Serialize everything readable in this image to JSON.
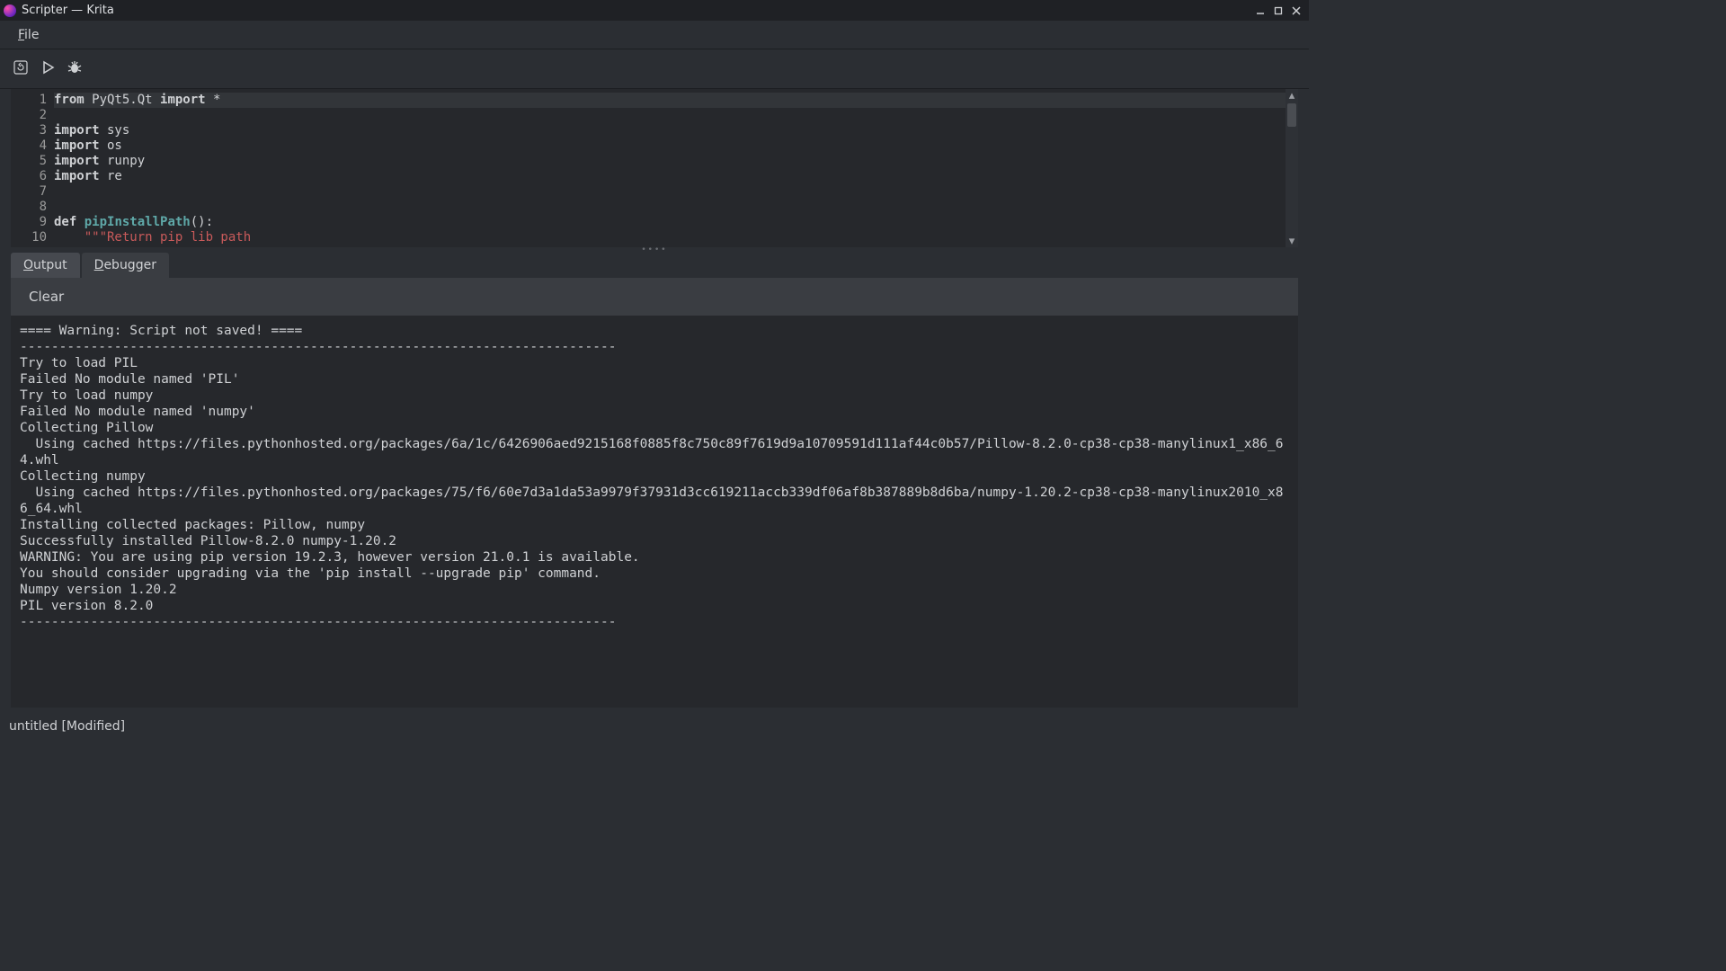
{
  "window": {
    "title": "Scripter — Krita"
  },
  "menubar": {
    "file": "File"
  },
  "editor": {
    "lines": [
      {
        "n": 1,
        "tokens": [
          [
            "kw",
            "from"
          ],
          [
            "",
            " PyQt5.Qt "
          ],
          [
            "kw",
            "import"
          ],
          [
            "",
            " *"
          ]
        ]
      },
      {
        "n": 2,
        "tokens": []
      },
      {
        "n": 3,
        "tokens": [
          [
            "kw",
            "import"
          ],
          [
            "",
            " sys"
          ]
        ]
      },
      {
        "n": 4,
        "tokens": [
          [
            "kw",
            "import"
          ],
          [
            "",
            " os"
          ]
        ]
      },
      {
        "n": 5,
        "tokens": [
          [
            "kw",
            "import"
          ],
          [
            "",
            " runpy"
          ]
        ]
      },
      {
        "n": 6,
        "tokens": [
          [
            "kw",
            "import"
          ],
          [
            "",
            " re"
          ]
        ]
      },
      {
        "n": 7,
        "tokens": []
      },
      {
        "n": 8,
        "tokens": []
      },
      {
        "n": 9,
        "tokens": [
          [
            "kw",
            "def"
          ],
          [
            "",
            " "
          ],
          [
            "fn",
            "pipInstallPath"
          ],
          [
            "",
            "():"
          ]
        ]
      },
      {
        "n": 10,
        "tokens": [
          [
            "",
            "    "
          ],
          [
            "str",
            "\"\"\"Return pip lib path"
          ]
        ]
      }
    ]
  },
  "tabs": {
    "output": "Output",
    "debugger": "Debugger"
  },
  "clear_label": "Clear",
  "output_text": "==== Warning: Script not saved! ====\n----------------------------------------------------------------------------\nTry to load PIL\nFailed No module named 'PIL'\nTry to load numpy\nFailed No module named 'numpy'\nCollecting Pillow\n  Using cached https://files.pythonhosted.org/packages/6a/1c/6426906aed9215168f0885f8c750c89f7619d9a10709591d111af44c0b57/Pillow-8.2.0-cp38-cp38-manylinux1_x86_64.whl\nCollecting numpy\n  Using cached https://files.pythonhosted.org/packages/75/f6/60e7d3a1da53a9979f37931d3cc619211accb339df06af8b387889b8d6ba/numpy-1.20.2-cp38-cp38-manylinux2010_x86_64.whl\nInstalling collected packages: Pillow, numpy\nSuccessfully installed Pillow-8.2.0 numpy-1.20.2\nWARNING: You are using pip version 19.2.3, however version 21.0.1 is available.\nYou should consider upgrading via the 'pip install --upgrade pip' command.\nNumpy version 1.20.2\nPIL version 8.2.0\n----------------------------------------------------------------------------\n",
  "statusbar": {
    "text": "untitled [Modified]"
  }
}
